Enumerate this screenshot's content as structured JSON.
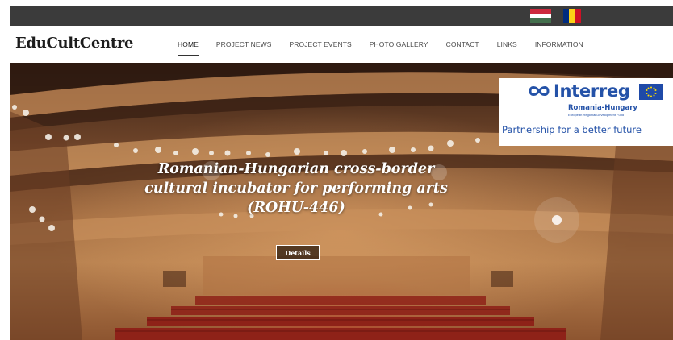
{
  "site": {
    "brand": "EduCultCentre"
  },
  "languages": [
    {
      "code": "hu",
      "icon": "hungary-flag-icon",
      "colors": [
        "#cd2a3e",
        "#ffffff",
        "#436f4d"
      ]
    },
    {
      "code": "ro",
      "icon": "romania-flag-icon",
      "colors": [
        "#002b7f",
        "#fcd116",
        "#ce1126"
      ]
    }
  ],
  "nav": {
    "items": [
      {
        "label": "HOME",
        "active": true
      },
      {
        "label": "PROJECT NEWS",
        "active": false
      },
      {
        "label": "PROJECT EVENTS",
        "active": false
      },
      {
        "label": "PHOTO GALLERY",
        "active": false
      },
      {
        "label": "CONTACT",
        "active": false
      },
      {
        "label": "LINKS",
        "active": false
      },
      {
        "label": "INFORMATION",
        "active": false
      }
    ]
  },
  "hero": {
    "title_line1": "Romanian-Hungarian cross-border",
    "title_line2": "cultural incubator for performing arts",
    "title_line3": "(ROHU-446)",
    "button_label": "Details"
  },
  "interreg": {
    "name": "Interreg",
    "program": "Romania-Hungary",
    "fund": "European Regional Development Fund",
    "slogan": "Partnership for a better future",
    "colors": {
      "brand_blue": "#2452a8",
      "eu_blue": "#1f4aa8",
      "eu_star": "#ffdd00"
    }
  },
  "colors": {
    "topbar": "#3b3b3b",
    "nav_bg": "#ffffff",
    "text_dark": "#1c1c1c"
  }
}
